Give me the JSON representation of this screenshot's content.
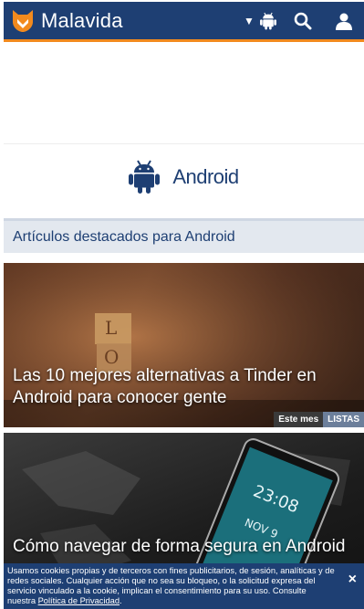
{
  "header": {
    "brand": "Malavida",
    "icons": [
      "fox-logo-icon",
      "chevron-down-icon",
      "android-icon",
      "search-icon",
      "user-icon"
    ],
    "colors": {
      "bar": "#1e3f73",
      "accent": "#f28a1e"
    }
  },
  "platform": {
    "label": "Android",
    "icon": "android-icon"
  },
  "section": {
    "title": "Artículos destacados para Android"
  },
  "articles": [
    {
      "title": "Las 10 mejores alternativas a Tinder en Android para conocer gente",
      "date_tag": "Este mes",
      "category_tag": "LISTAS"
    },
    {
      "title": "Cómo navegar de forma segura en Android"
    }
  ],
  "cookie_banner": {
    "text": "Usamos cookies propias y de terceros con fines publicitarios, de sesión, analíticas y de redes sociales. Cualquier acción que no sea su bloqueo, o la solicitud expresa del servicio vinculado a la cookie, implican el consentimiento para su uso. Consulte nuestra ",
    "link_text": "Política de Privacidad",
    "suffix": ".",
    "close_label": "×"
  }
}
